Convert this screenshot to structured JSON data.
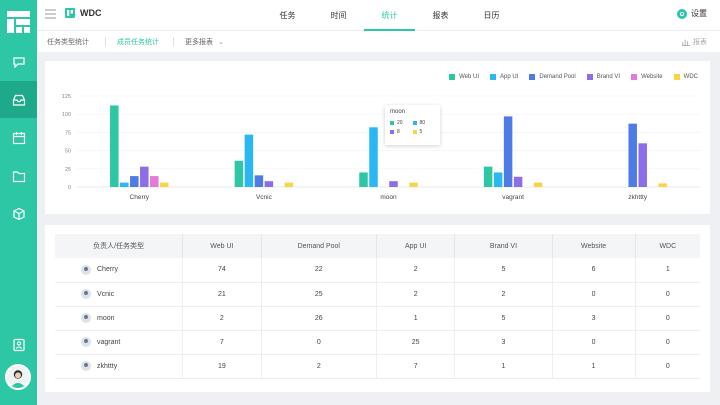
{
  "header": {
    "brand": "WDC",
    "tabs": [
      {
        "label": "任务"
      },
      {
        "label": "时间"
      },
      {
        "label": "统计"
      },
      {
        "label": "报表"
      },
      {
        "label": "日历"
      }
    ],
    "settings_label": "设置"
  },
  "subnav": {
    "items": [
      {
        "label": "任务类型统计"
      },
      {
        "label": "成员任务统计"
      },
      {
        "label": "更多报表"
      }
    ],
    "report_label": "报表"
  },
  "colors": {
    "accent": "#2dc7a5",
    "series": [
      "#2dc7a5",
      "#2ab7f2",
      "#4e7ce6",
      "#8c6ee8",
      "#e27ad8",
      "#f7d545"
    ]
  },
  "chart_data": {
    "type": "bar",
    "categories": [
      "Cherry",
      "Vcnic",
      "moon",
      "vagrant",
      "zkhttty"
    ],
    "series": [
      {
        "name": "Web UI",
        "values": [
          112,
          36,
          20,
          28,
          0
        ]
      },
      {
        "name": "App UI",
        "values": [
          6,
          72,
          82,
          20,
          0
        ]
      },
      {
        "name": "Demand Pool",
        "values": [
          15,
          16,
          0,
          97,
          87
        ]
      },
      {
        "name": "Brand VI",
        "values": [
          28,
          8,
          8,
          14,
          60
        ]
      },
      {
        "name": "Website",
        "values": [
          15,
          0,
          0,
          0,
          0
        ]
      },
      {
        "name": "WDC",
        "values": [
          6,
          6,
          6,
          6,
          5
        ]
      }
    ],
    "ylim": [
      0,
      125
    ],
    "yticks": [
      0,
      25,
      50,
      75,
      100,
      125
    ],
    "legend_position": "top-right",
    "tooltip": {
      "title": "moon",
      "entries": [
        {
          "value": "20"
        },
        {
          "value": "80"
        },
        {
          "value": "8"
        },
        {
          "value": "5"
        }
      ]
    }
  },
  "table": {
    "columns": [
      "负责人/任务类型",
      "Web UI",
      "Demand Pool",
      "App UI",
      "Brand VI",
      "Website",
      "WDC"
    ],
    "rows": [
      {
        "name": "Cherry",
        "cells": [
          "74",
          "22",
          "2",
          "5",
          "6",
          "1"
        ]
      },
      {
        "name": "Vcnic",
        "cells": [
          "21",
          "25",
          "2",
          "2",
          "0",
          "0"
        ]
      },
      {
        "name": "moon",
        "cells": [
          "2",
          "26",
          "1",
          "5",
          "3",
          "0"
        ]
      },
      {
        "name": "vagrant",
        "cells": [
          "7",
          "0",
          "25",
          "3",
          "0",
          "0"
        ]
      },
      {
        "name": "zkhttty",
        "cells": [
          "19",
          "2",
          "7",
          "1",
          "1",
          "0"
        ]
      }
    ]
  }
}
